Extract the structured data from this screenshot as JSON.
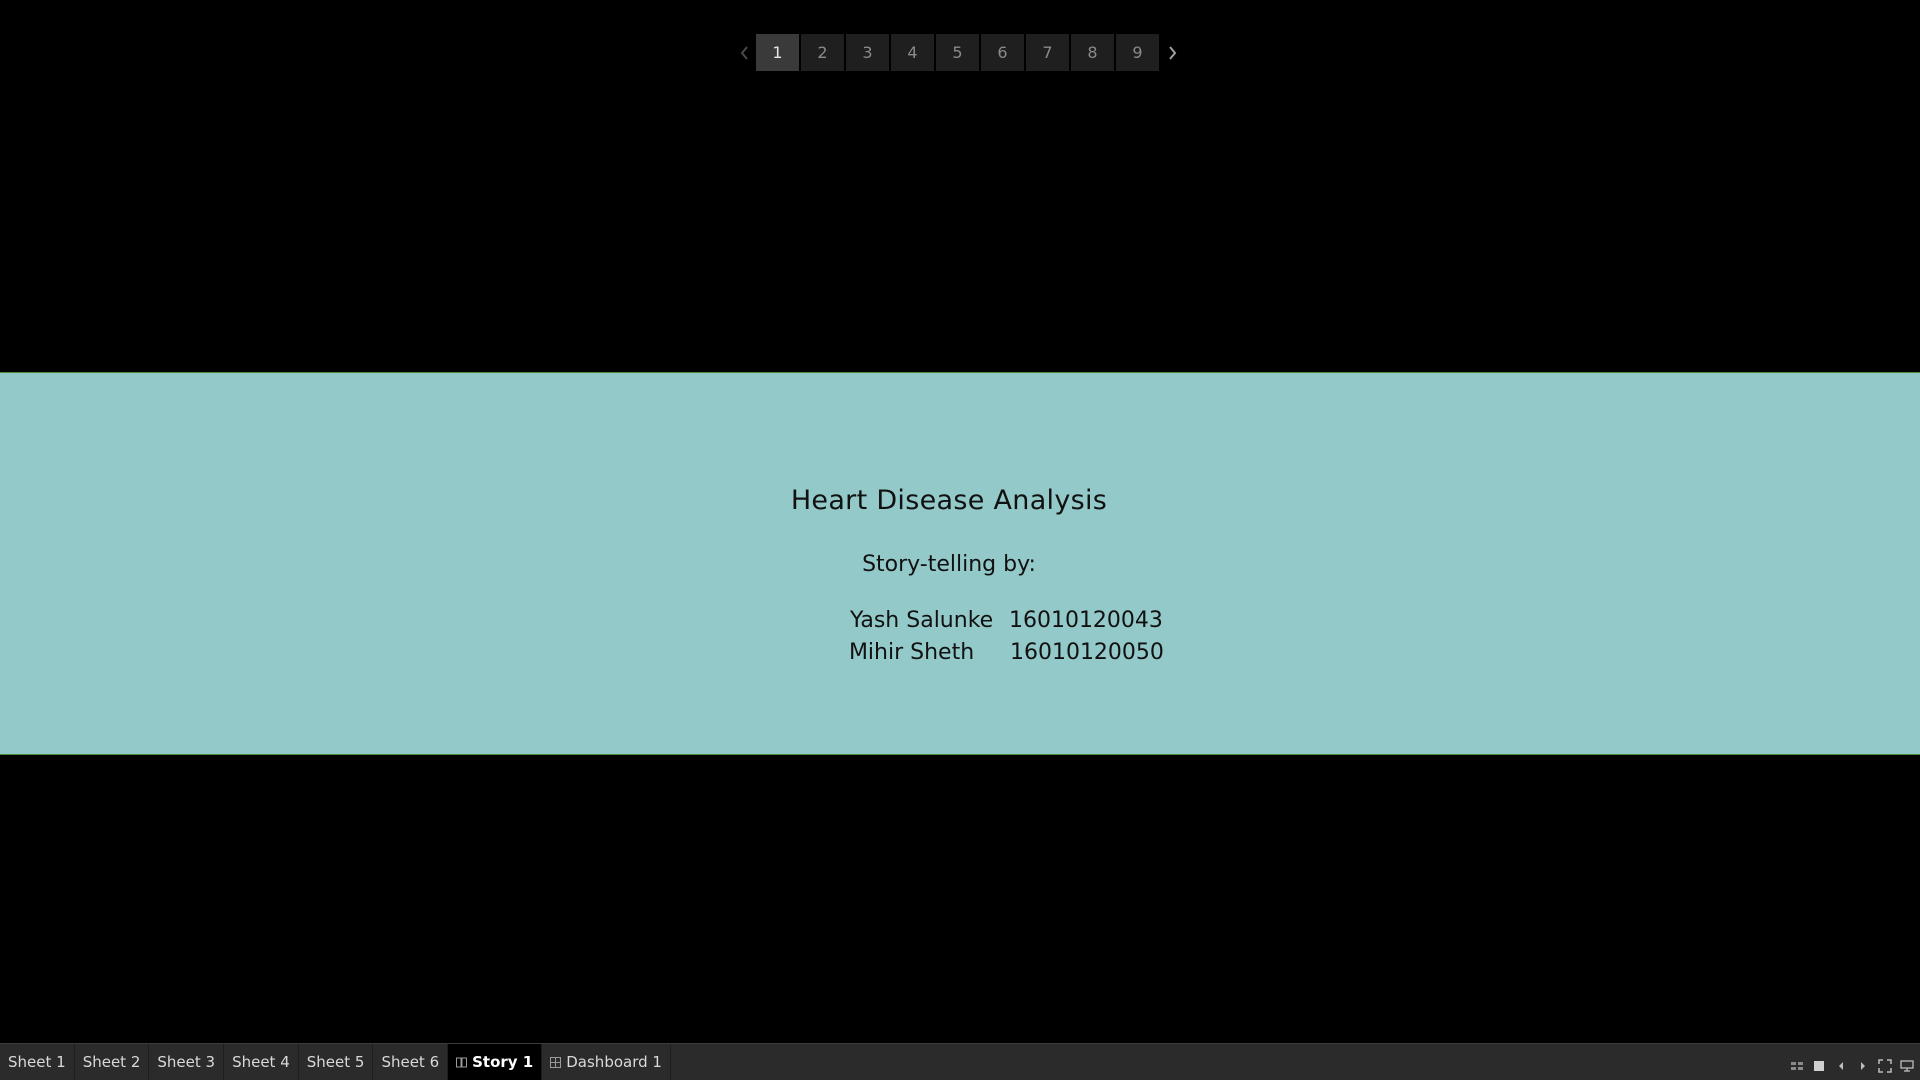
{
  "story_nav": {
    "points": [
      "1",
      "2",
      "3",
      "4",
      "5",
      "6",
      "7",
      "8",
      "9"
    ],
    "active_point": "1"
  },
  "story_point": {
    "title": "Heart Disease Analysis",
    "byline": "Story-telling by:",
    "authors": [
      {
        "name": "Yash Salunke",
        "id": "16010120043"
      },
      {
        "name": "Mihir Sheth",
        "id": "16010120050"
      }
    ],
    "background_color": "#94c9c9"
  },
  "tabs": [
    {
      "label": "Sheet 1",
      "type": "sheet"
    },
    {
      "label": "Sheet 2",
      "type": "sheet"
    },
    {
      "label": "Sheet 3",
      "type": "sheet"
    },
    {
      "label": "Sheet 4",
      "type": "sheet"
    },
    {
      "label": "Sheet 5",
      "type": "sheet"
    },
    {
      "label": "Sheet 6",
      "type": "sheet"
    },
    {
      "label": "Story 1",
      "type": "story",
      "active": true
    },
    {
      "label": "Dashboard 1",
      "type": "dashboard"
    }
  ],
  "tab_controls": [
    "show-sheet-sorter-icon",
    "show-tabs-icon",
    "previous-sheet-icon",
    "next-sheet-icon",
    "presentation-mode-icon",
    "show-filmstrip-icon"
  ]
}
